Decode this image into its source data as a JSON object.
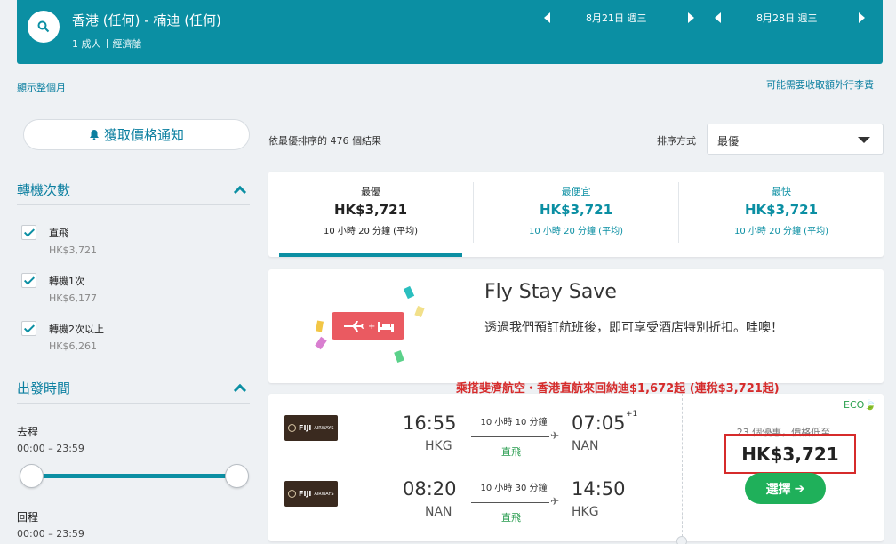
{
  "header": {
    "route": "香港 (任何) - 楠迪 (任何)",
    "passengers": "1 成人",
    "cabin": "經濟艙",
    "depart_date": "8月21日 週三",
    "return_date": "8月28日 週三"
  },
  "links": {
    "show_month": "顯示整個月",
    "baggage_fee": "可能需要收取額外行李費"
  },
  "sidebar": {
    "price_alert": "獲取價格通知",
    "stops_title": "轉機次數",
    "stops": [
      {
        "label": "直飛",
        "price": "HK$3,721"
      },
      {
        "label": "轉機1次",
        "price": "HK$6,177"
      },
      {
        "label": "轉機2次以上",
        "price": "HK$6,261"
      }
    ],
    "times_title": "出發時間",
    "outbound_label": "去程",
    "outbound_range": "00:00 – 23:59",
    "return_label": "回程",
    "return_range": "00:00 – 23:59"
  },
  "results": {
    "count_text": "依最優排序的 476 個結果",
    "sort_label": "排序方式",
    "sort_value": "最優"
  },
  "tabs": [
    {
      "title": "最優",
      "price": "HK$3,721",
      "duration": "10 小時 20 分鐘 (平均)"
    },
    {
      "title": "最便宜",
      "price": "HK$3,721",
      "duration": "10 小時 20 分鐘 (平均)"
    },
    {
      "title": "最快",
      "price": "HK$3,721",
      "duration": "10 小時 20 分鐘 (平均)"
    }
  ],
  "promo": {
    "title": "Fly Stay Save",
    "text": "透過我們預訂航班後，即可享受酒店特別折扣。哇噢！"
  },
  "flight": {
    "headline": "乘搭斐濟航空・香港直航來回納迪$1,672起 (連稅$3,721起)",
    "airline": "FIJI",
    "airline_sub": "AIRWAYS",
    "eco": "ECO",
    "outbound": {
      "dep_time": "16:55",
      "dep_apt": "HKG",
      "duration": "10 小時 10 分鐘",
      "stops": "直飛",
      "arr_time": "07:05",
      "arr_apt": "NAN",
      "day_offset": "+1"
    },
    "inbound": {
      "dep_time": "08:20",
      "dep_apt": "NAN",
      "duration": "10 小時 30 分鐘",
      "stops": "直飛",
      "arr_time": "14:50",
      "arr_apt": "HKG"
    },
    "deals": "23 個優惠，價格低至",
    "price": "HK$3,721",
    "select_label": "選擇"
  },
  "colors": {
    "brand": "#0b8fa3",
    "select_green": "#1fb05a",
    "highlight_red": "#d62b2b"
  }
}
